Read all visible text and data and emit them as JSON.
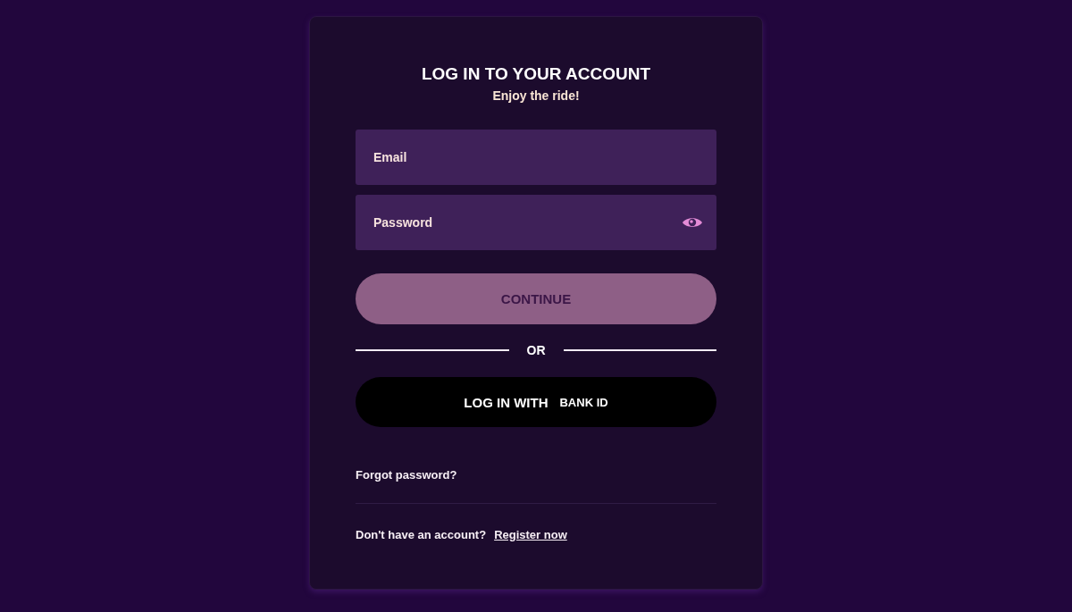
{
  "card": {
    "title": "LOG IN TO YOUR ACCOUNT",
    "subtitle": "Enjoy the ride!"
  },
  "fields": [
    {
      "kind": "email",
      "placeholder": "Email"
    },
    {
      "kind": "password",
      "placeholder": "Password"
    }
  ],
  "continue_button": {
    "label": "CONTINUE",
    "disabled": true
  },
  "divider_label": "OR",
  "bank_id_button": {
    "label": "LOG IN WITH",
    "logo_text": "BANK ID"
  },
  "forgot_password_link": "Forgot password?",
  "register": {
    "prompt": "Don't have an account?",
    "link": "Register now"
  }
}
